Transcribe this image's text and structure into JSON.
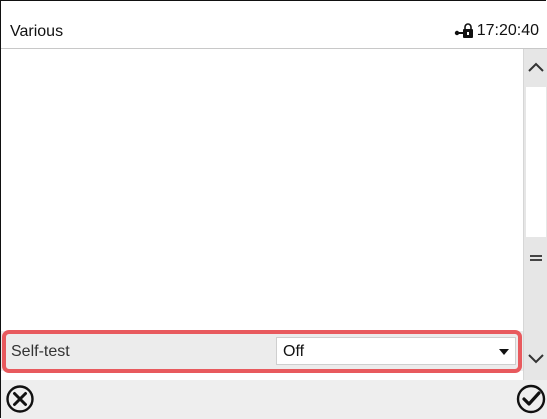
{
  "header": {
    "title": "Various",
    "time": "17:20:40",
    "lock_icon": "unlock-icon"
  },
  "settings": [
    {
      "label": "Self-test",
      "value": "Off"
    }
  ],
  "footer": {
    "cancel_icon": "cancel-circle-icon",
    "confirm_icon": "confirm-check-icon"
  },
  "colors": {
    "highlight": "#e85a5e",
    "row_background": "#ececec",
    "scrollbar": "#e6e6e6"
  }
}
